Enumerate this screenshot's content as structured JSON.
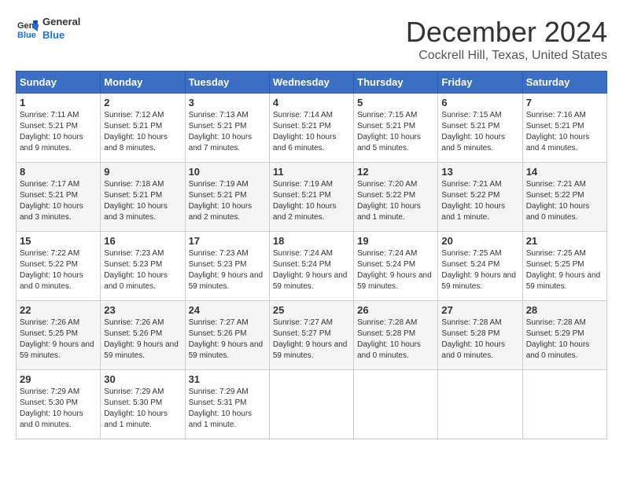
{
  "logo": {
    "line1": "General",
    "line2": "Blue"
  },
  "title": "December 2024",
  "location": "Cockrell Hill, Texas, United States",
  "weekdays": [
    "Sunday",
    "Monday",
    "Tuesday",
    "Wednesday",
    "Thursday",
    "Friday",
    "Saturday"
  ],
  "weeks": [
    [
      {
        "day": "1",
        "sunrise": "7:11 AM",
        "sunset": "5:21 PM",
        "daylight": "10 hours and 9 minutes."
      },
      {
        "day": "2",
        "sunrise": "7:12 AM",
        "sunset": "5:21 PM",
        "daylight": "10 hours and 8 minutes."
      },
      {
        "day": "3",
        "sunrise": "7:13 AM",
        "sunset": "5:21 PM",
        "daylight": "10 hours and 7 minutes."
      },
      {
        "day": "4",
        "sunrise": "7:14 AM",
        "sunset": "5:21 PM",
        "daylight": "10 hours and 6 minutes."
      },
      {
        "day": "5",
        "sunrise": "7:15 AM",
        "sunset": "5:21 PM",
        "daylight": "10 hours and 5 minutes."
      },
      {
        "day": "6",
        "sunrise": "7:15 AM",
        "sunset": "5:21 PM",
        "daylight": "10 hours and 5 minutes."
      },
      {
        "day": "7",
        "sunrise": "7:16 AM",
        "sunset": "5:21 PM",
        "daylight": "10 hours and 4 minutes."
      }
    ],
    [
      {
        "day": "8",
        "sunrise": "7:17 AM",
        "sunset": "5:21 PM",
        "daylight": "10 hours and 3 minutes."
      },
      {
        "day": "9",
        "sunrise": "7:18 AM",
        "sunset": "5:21 PM",
        "daylight": "10 hours and 3 minutes."
      },
      {
        "day": "10",
        "sunrise": "7:19 AM",
        "sunset": "5:21 PM",
        "daylight": "10 hours and 2 minutes."
      },
      {
        "day": "11",
        "sunrise": "7:19 AM",
        "sunset": "5:21 PM",
        "daylight": "10 hours and 2 minutes."
      },
      {
        "day": "12",
        "sunrise": "7:20 AM",
        "sunset": "5:22 PM",
        "daylight": "10 hours and 1 minute."
      },
      {
        "day": "13",
        "sunrise": "7:21 AM",
        "sunset": "5:22 PM",
        "daylight": "10 hours and 1 minute."
      },
      {
        "day": "14",
        "sunrise": "7:21 AM",
        "sunset": "5:22 PM",
        "daylight": "10 hours and 0 minutes."
      }
    ],
    [
      {
        "day": "15",
        "sunrise": "7:22 AM",
        "sunset": "5:22 PM",
        "daylight": "10 hours and 0 minutes."
      },
      {
        "day": "16",
        "sunrise": "7:23 AM",
        "sunset": "5:23 PM",
        "daylight": "10 hours and 0 minutes."
      },
      {
        "day": "17",
        "sunrise": "7:23 AM",
        "sunset": "5:23 PM",
        "daylight": "9 hours and 59 minutes."
      },
      {
        "day": "18",
        "sunrise": "7:24 AM",
        "sunset": "5:24 PM",
        "daylight": "9 hours and 59 minutes."
      },
      {
        "day": "19",
        "sunrise": "7:24 AM",
        "sunset": "5:24 PM",
        "daylight": "9 hours and 59 minutes."
      },
      {
        "day": "20",
        "sunrise": "7:25 AM",
        "sunset": "5:24 PM",
        "daylight": "9 hours and 59 minutes."
      },
      {
        "day": "21",
        "sunrise": "7:25 AM",
        "sunset": "5:25 PM",
        "daylight": "9 hours and 59 minutes."
      }
    ],
    [
      {
        "day": "22",
        "sunrise": "7:26 AM",
        "sunset": "5:25 PM",
        "daylight": "9 hours and 59 minutes."
      },
      {
        "day": "23",
        "sunrise": "7:26 AM",
        "sunset": "5:26 PM",
        "daylight": "9 hours and 59 minutes."
      },
      {
        "day": "24",
        "sunrise": "7:27 AM",
        "sunset": "5:26 PM",
        "daylight": "9 hours and 59 minutes."
      },
      {
        "day": "25",
        "sunrise": "7:27 AM",
        "sunset": "5:27 PM",
        "daylight": "9 hours and 59 minutes."
      },
      {
        "day": "26",
        "sunrise": "7:28 AM",
        "sunset": "5:28 PM",
        "daylight": "10 hours and 0 minutes."
      },
      {
        "day": "27",
        "sunrise": "7:28 AM",
        "sunset": "5:28 PM",
        "daylight": "10 hours and 0 minutes."
      },
      {
        "day": "28",
        "sunrise": "7:28 AM",
        "sunset": "5:29 PM",
        "daylight": "10 hours and 0 minutes."
      }
    ],
    [
      {
        "day": "29",
        "sunrise": "7:29 AM",
        "sunset": "5:30 PM",
        "daylight": "10 hours and 0 minutes."
      },
      {
        "day": "30",
        "sunrise": "7:29 AM",
        "sunset": "5:30 PM",
        "daylight": "10 hours and 1 minute."
      },
      {
        "day": "31",
        "sunrise": "7:29 AM",
        "sunset": "5:31 PM",
        "daylight": "10 hours and 1 minute."
      },
      null,
      null,
      null,
      null
    ]
  ],
  "labels": {
    "sunrise": "Sunrise:",
    "sunset": "Sunset:",
    "daylight": "Daylight:"
  }
}
